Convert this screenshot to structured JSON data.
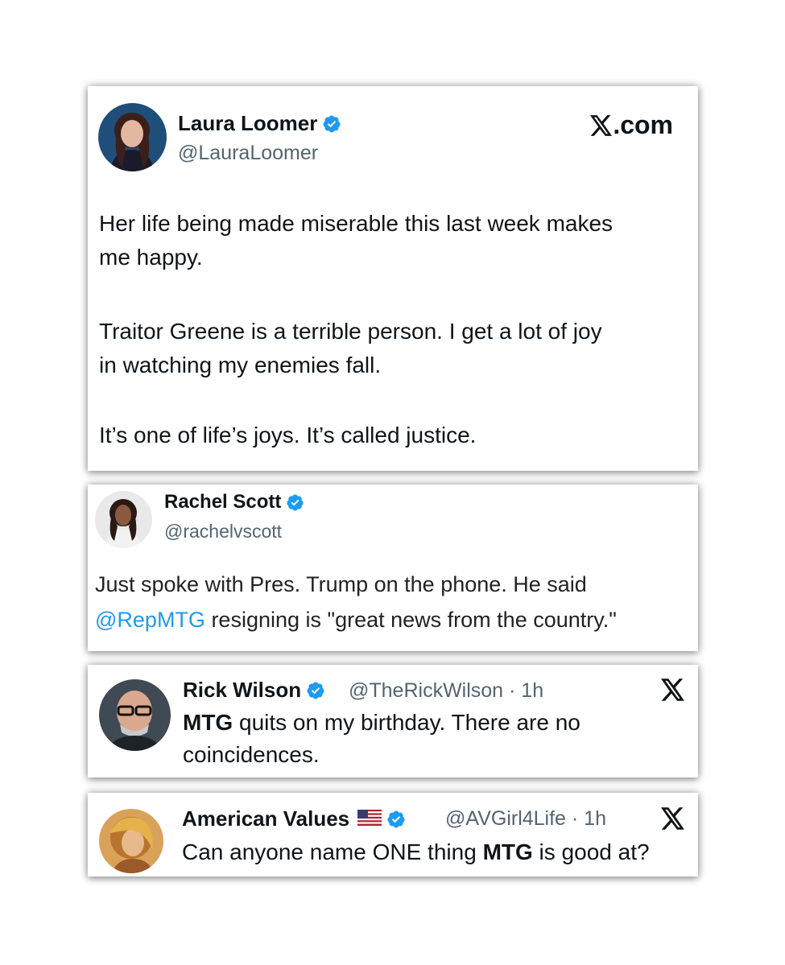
{
  "accent_color": "#1d9bf0",
  "posts": [
    {
      "name": "Laura Loomer",
      "verified": true,
      "handle": "@LauraLoomer",
      "source_label": "com",
      "paragraphs": [
        [
          "Her life being made miserable this last week makes",
          "me happy."
        ],
        [
          "Traitor Greene is a terrible person. I get a lot of joy",
          "in watching my enemies fall."
        ],
        [
          "It’s one of life’s joys. It’s called justice."
        ]
      ]
    },
    {
      "name": "Rachel Scott",
      "verified": true,
      "handle": "@rachelvscott",
      "line1": "Just spoke with Pres. Trump on the phone. He said",
      "mention": "@RepMTG",
      "line2_rest": " resigning is \"great news from the country.\""
    },
    {
      "name": "Rick Wilson",
      "verified": true,
      "handle": "@TheRickWilson · 1h",
      "line1_bold": "MTG",
      "line1_rest": " quits on my birthday. There are no",
      "line2": "coincidences."
    },
    {
      "name": "American Values",
      "flag_icon": "us-flag-icon",
      "verified": true,
      "handle": "@AVGirl4Life · 1h",
      "pre": "Can anyone name ONE thing ",
      "bold": "MTG",
      "post": " is good at?"
    }
  ]
}
